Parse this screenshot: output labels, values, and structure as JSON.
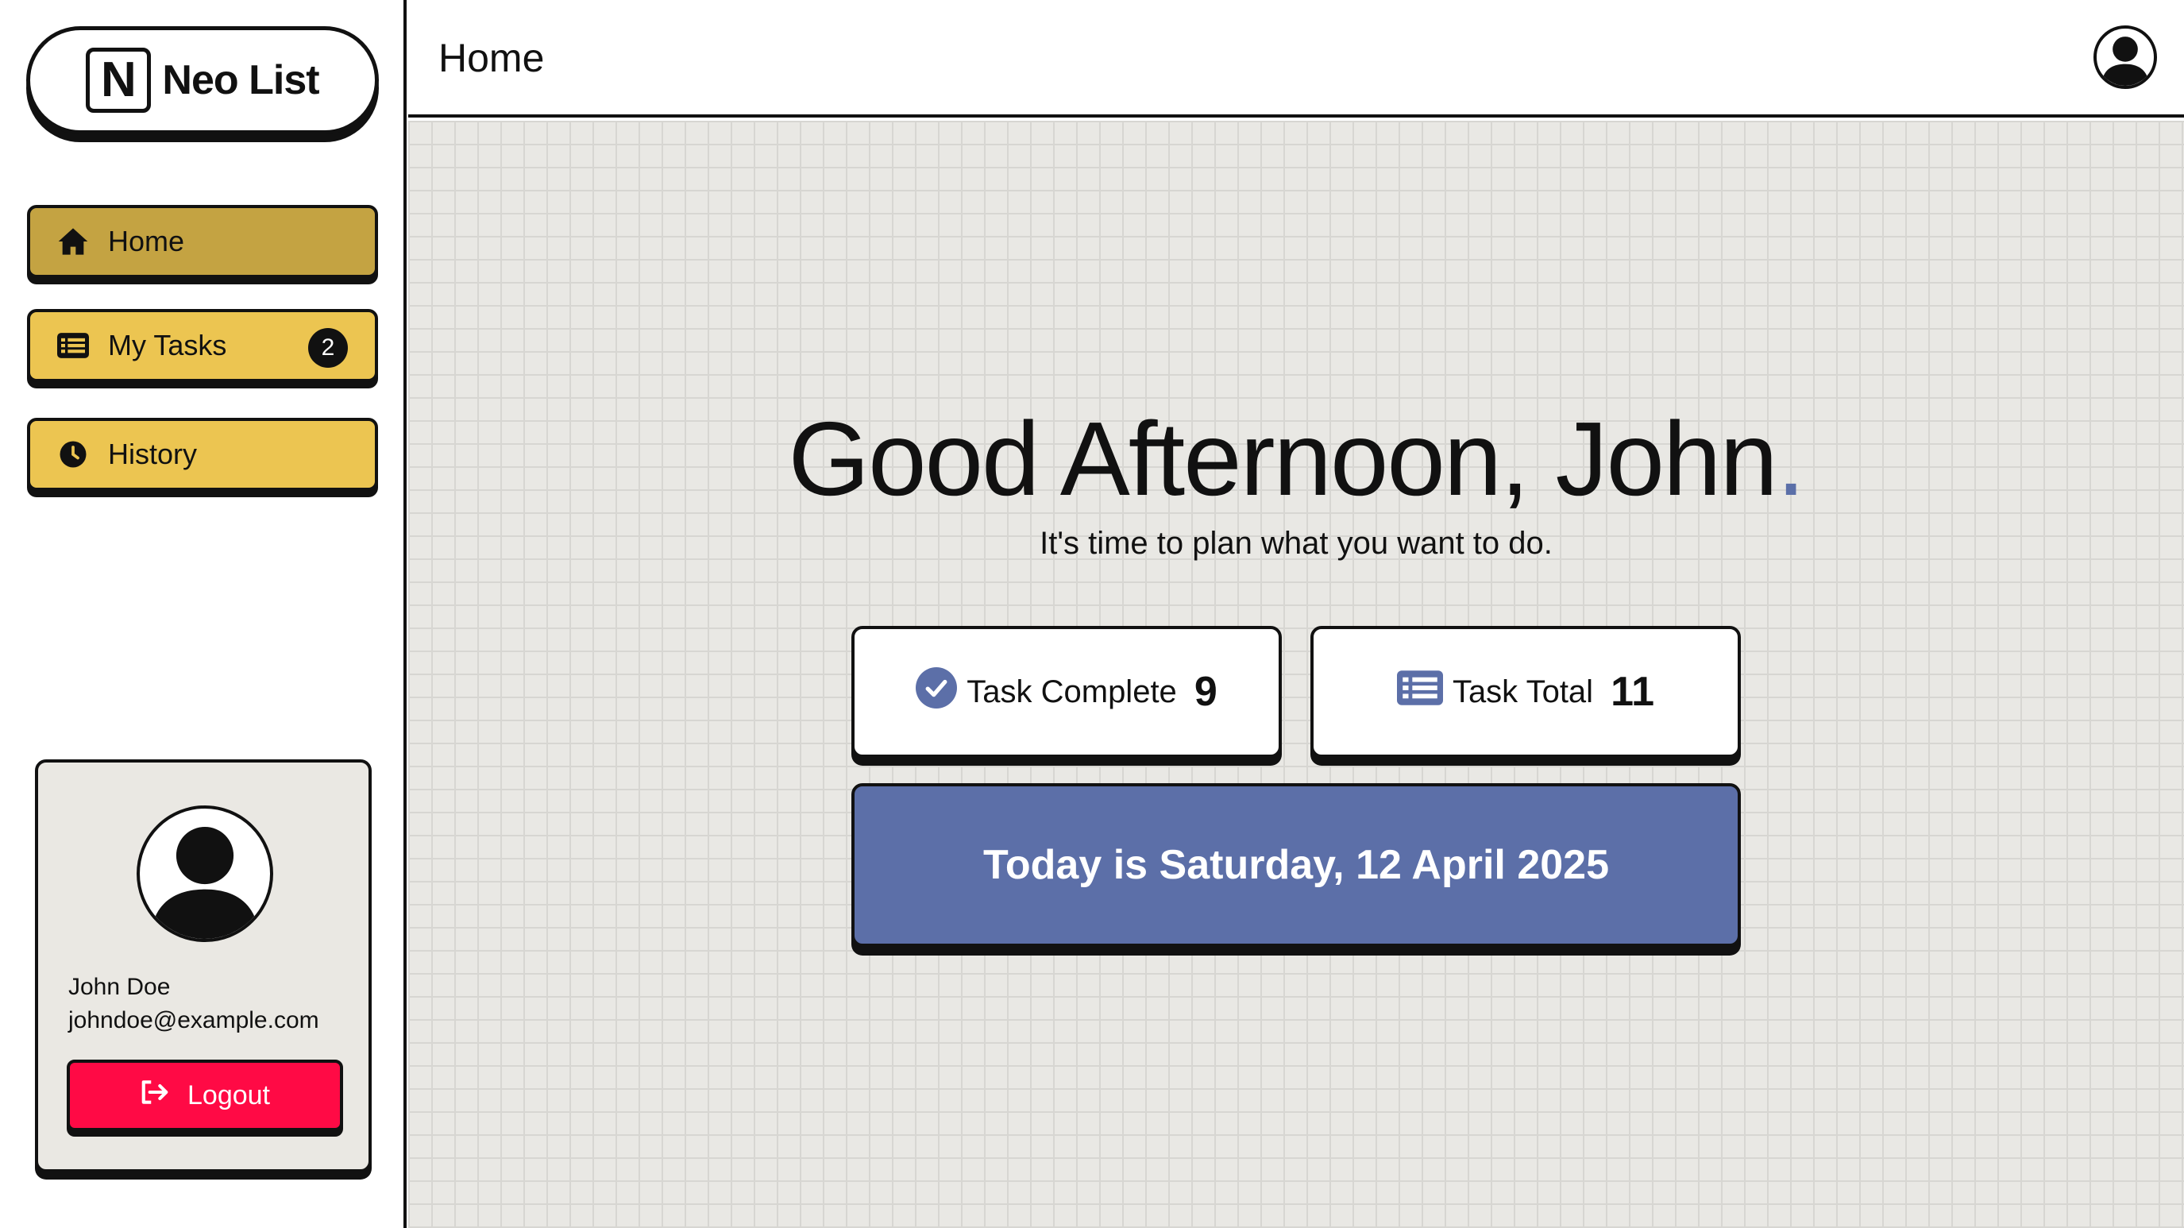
{
  "app": {
    "logo_letter": "N",
    "name": "Neo List"
  },
  "sidebar": {
    "items": [
      {
        "label": "Home",
        "icon": "home-icon"
      },
      {
        "label": "My Tasks",
        "icon": "list-icon",
        "badge": "2"
      },
      {
        "label": "History",
        "icon": "clock-icon"
      }
    ]
  },
  "profile": {
    "name": "John Doe",
    "email": "johndoe@example.com",
    "logout_label": "Logout"
  },
  "header": {
    "title": "Home"
  },
  "main": {
    "greeting": "Good Afternoon, John",
    "greeting_dot": ".",
    "subtitle": "It's time to plan what you want to do.",
    "stats": [
      {
        "label": "Task Complete",
        "value": "9",
        "icon": "check-circle-icon"
      },
      {
        "label": "Task Total",
        "value": "11",
        "icon": "list-icon"
      }
    ],
    "date_text": "Today is Saturday, 12 April 2025"
  },
  "colors": {
    "accent_blue": "#5c6fa8",
    "nav_active": "#c4a342",
    "nav_default": "#ecc551",
    "logout_red": "#ff0a45",
    "background": "#e9e8e4"
  }
}
